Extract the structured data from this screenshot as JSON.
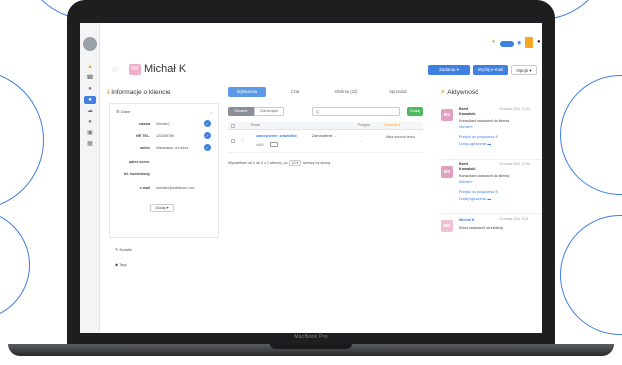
{
  "device_label": "MacBook Pro",
  "topbar": {
    "zadania_label": "Zadania",
    "wyslij_mail_label": "Wyślij e-mail",
    "opcje_label": "Opcje",
    "user_initials": "DW"
  },
  "page": {
    "title": "Michał K",
    "avatar_initials": "MK"
  },
  "client_info": {
    "heading": "Informacje o kliencie",
    "section_dane": "Dane",
    "rows": [
      {
        "label": "nazwa",
        "value": "Michał K"
      },
      {
        "label": "NR TEL.",
        "value": "123456789"
      },
      {
        "label": "adres",
        "value": "Warszawa, ul Leśna"
      },
      {
        "label": "adres kores.",
        "value": ""
      },
      {
        "label": "tel. komórkowy",
        "value": ""
      },
      {
        "label": "e-mail",
        "value": "michał.k@edetsoa.c om"
      }
    ],
    "dodaj_label": "Dodaj",
    "section_notatki": "Notatki",
    "section_tagi": "Tagi"
  },
  "tabs": [
    {
      "label": "Zgłoszenia",
      "active": true
    },
    {
      "label": "Czat",
      "active": false
    },
    {
      "label": "Infolinia (22)",
      "active": false
    },
    {
      "label": "Sprzedaż",
      "active": false
    }
  ],
  "tickets": {
    "filter_open": "Otwarte",
    "filter_closed": "Zamknięte",
    "search_placeholder": "Q",
    "dodaj_label": "Dodaj",
    "col_temat": "Temat",
    "col_przypis": "Przypis.",
    "col_ostatnia": "Ostatnia",
    "row_title": "zamówienie: zdarkdirb",
    "row_status": "Zamówienie ...",
    "row_id": "4491",
    "row_time": "kilka sekund temu",
    "summary": "Wyświetlam od 0 do 0 z 1 wierszy, po",
    "per_page": "10",
    "summary_tail": "wierszy na stronę"
  },
  "activity": {
    "heading": "Aktywność",
    "items": [
      {
        "initials": "BS",
        "name": "Brett Kowalski",
        "date": "15 marca 2021, 10:32",
        "text": "Konsultant zadzwonił do klienta",
        "client": "Michał K",
        "link1": "Przejdź do połączenia",
        "link2": "Dodaj zgłoszenie"
      },
      {
        "initials": "BS",
        "name": "Brett Kowalski",
        "date": "15 marca 2021, 10:30",
        "text": "Konsultant zadzwonił do klienta",
        "client": "Michał K",
        "link1": "Przejdź do połączenia",
        "link2": "Dodaj zgłoszenie"
      },
      {
        "initials": "MK",
        "name": "Michał K",
        "date": "15 marca 2021, 8:21",
        "text": "Klient zadzwonił na infolinię",
        "client": "",
        "link1": "",
        "link2": ""
      }
    ]
  },
  "colors": {
    "accent": "#3f7fe0",
    "orange": "#f5a623",
    "pink": "#e8a0bb"
  }
}
